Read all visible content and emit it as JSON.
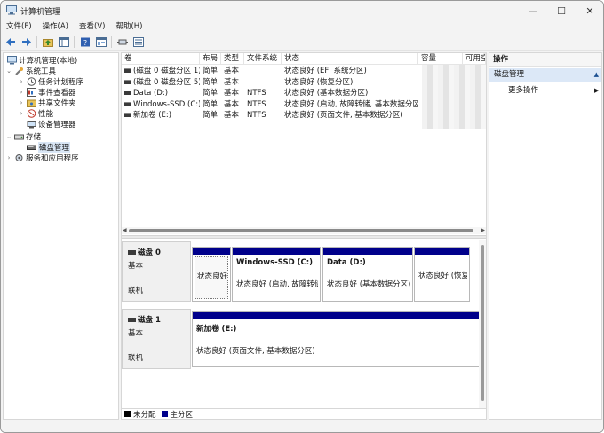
{
  "window": {
    "title": "计算机管理",
    "minimize_glyph": "—",
    "maximize_glyph": "☐",
    "close_glyph": "✕"
  },
  "menu": [
    "文件(F)",
    "操作(A)",
    "查看(V)",
    "帮助(H)"
  ],
  "toolbar_icons": [
    "back-arrow-icon",
    "forward-arrow-icon",
    "folder-up-icon",
    "show-hide-tree-icon",
    "help-icon",
    "properties-icon",
    "connect-icon",
    "view-icon"
  ],
  "tree": {
    "root": "计算机管理(本地)",
    "system_tools": "系统工具",
    "task_scheduler": "任务计划程序",
    "event_viewer": "事件查看器",
    "shared_folders": "共享文件夹",
    "performance": "性能",
    "device_manager": "设备管理器",
    "storage": "存储",
    "disk_management": "磁盘管理",
    "services_apps": "服务和应用程序"
  },
  "volume_table": {
    "columns": [
      "卷",
      "布局",
      "类型",
      "文件系统",
      "状态",
      "容量",
      "可用空"
    ],
    "rows": [
      {
        "volume": "(磁盘 0 磁盘分区 1)",
        "layout": "简单",
        "type": "基本",
        "fs": "",
        "status": "状态良好 (EFI 系统分区)"
      },
      {
        "volume": "(磁盘 0 磁盘分区 5)",
        "layout": "简单",
        "type": "基本",
        "fs": "",
        "status": "状态良好 (恢复分区)"
      },
      {
        "volume": "Data (D:)",
        "layout": "简单",
        "type": "基本",
        "fs": "NTFS",
        "status": "状态良好 (基本数据分区)"
      },
      {
        "volume": "Windows-SSD (C:)",
        "layout": "简单",
        "type": "基本",
        "fs": "NTFS",
        "status": "状态良好 (启动, 故障转储, 基本数据分区)"
      },
      {
        "volume": "新加卷 (E:)",
        "layout": "简单",
        "type": "基本",
        "fs": "NTFS",
        "status": "状态良好 (页面文件, 基本数据分区)"
      }
    ]
  },
  "disks": [
    {
      "name": "磁盘 0",
      "kind": "基本",
      "status": "联机",
      "partitions": [
        {
          "name": "",
          "status": "状态良好"
        },
        {
          "name": "Windows-SSD (C:)",
          "status": "状态良好 (启动, 故障转储"
        },
        {
          "name": "Data (D:)",
          "status": "状态良好 (基本数据分区)"
        },
        {
          "name": "",
          "status": "状态良好 (恢复"
        }
      ]
    },
    {
      "name": "磁盘 1",
      "kind": "基本",
      "status": "联机",
      "partitions": [
        {
          "name": "新加卷 (E:)",
          "status": "状态良好 (页面文件, 基本数据分区)"
        }
      ]
    }
  ],
  "legend": [
    {
      "label": "未分配",
      "color": "#000000"
    },
    {
      "label": "主分区",
      "color": "#00008b"
    }
  ],
  "actions": {
    "header": "操作",
    "section": "磁盘管理",
    "more": "更多操作"
  },
  "colors": {
    "primary_partition": "#00008b",
    "selection": "#d9e6f5",
    "action_section": "#dce8f7"
  }
}
